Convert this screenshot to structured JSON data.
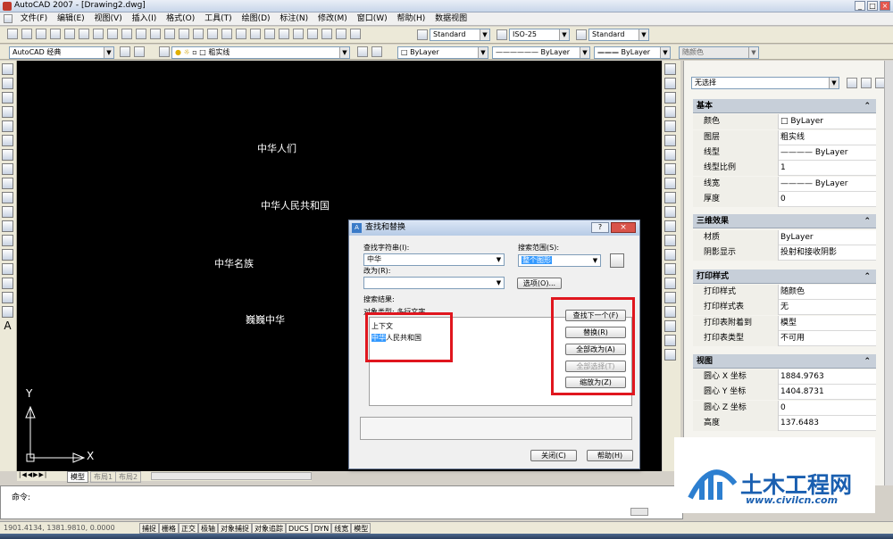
{
  "app": {
    "title": "AutoCAD 2007 - [Drawing2.dwg]"
  },
  "menu": [
    "文件(F)",
    "编辑(E)",
    "视图(V)",
    "插入(I)",
    "格式(O)",
    "工具(T)",
    "绘图(D)",
    "标注(N)",
    "修改(M)",
    "窗口(W)",
    "帮助(H)",
    "数据视图"
  ],
  "toolbar": {
    "text_style": "Standard",
    "dim_style": "ISO-25",
    "table_style": "Standard",
    "workspace": "AutoCAD 经典",
    "layer": "粗实线",
    "color": "ByLayer",
    "linetype": "ByLayer",
    "lineweight": "ByLayer",
    "plotstyle": "随颜色"
  },
  "canvas": {
    "texts": [
      "中华人们",
      "中华人民共和国",
      "中华名族",
      "巍巍中华"
    ],
    "ucs_y": "Y",
    "ucs_x": "X"
  },
  "layout_tabs": [
    "模型",
    "布局1",
    "布局2"
  ],
  "command": {
    "prompt": "命令:"
  },
  "status": {
    "coords": "1901.4134, 1381.9810, 0.0000",
    "toggles": [
      "捕捉",
      "栅格",
      "正交",
      "极轴",
      "对象捕捉",
      "对象追踪",
      "DUCS",
      "DYN",
      "线宽",
      "模型"
    ]
  },
  "properties": {
    "selection": "无选择",
    "sections": [
      {
        "title": "基本",
        "rows": [
          [
            "颜色",
            "□ ByLayer"
          ],
          [
            "图层",
            "粗实线"
          ],
          [
            "线型",
            "———— ByLayer"
          ],
          [
            "线型比例",
            "1"
          ],
          [
            "线宽",
            "———— ByLayer"
          ],
          [
            "厚度",
            "0"
          ]
        ]
      },
      {
        "title": "三维效果",
        "rows": [
          [
            "材质",
            "ByLayer"
          ],
          [
            "阴影显示",
            "投射和接收阴影"
          ]
        ]
      },
      {
        "title": "打印样式",
        "rows": [
          [
            "打印样式",
            "随颜色"
          ],
          [
            "打印样式表",
            "无"
          ],
          [
            "打印表附着到",
            "模型"
          ],
          [
            "打印表类型",
            "不可用"
          ]
        ]
      },
      {
        "title": "视图",
        "rows": [
          [
            "圆心 X 坐标",
            "1884.9763"
          ],
          [
            "圆心 Y 坐标",
            "1404.8731"
          ],
          [
            "圆心 Z 坐标",
            "0"
          ],
          [
            "高度",
            "137.6483"
          ]
        ]
      }
    ]
  },
  "dialog": {
    "title": "查找和替换",
    "find_label": "查找字符串(I):",
    "find_value": "中华",
    "replace_label": "改为(R):",
    "replace_value": "",
    "scope_label": "搜索范围(S):",
    "scope_value": "整个图形",
    "options_button": "选项(O)...",
    "results_label": "搜索结果:",
    "object_type": "对象类型: 多行文字",
    "context_label": "上下文",
    "context_highlight": "中华",
    "context_rest": "人民共和国",
    "find_next": "查找下一个(F)",
    "replace": "替换(R)",
    "replace_all": "全部改为(A)",
    "select_all": "全部选择(T)",
    "zoom_to": "缩放为(Z)",
    "close": "关闭(C)",
    "help": "帮助(H)"
  },
  "watermark": {
    "brand": "土木工程网",
    "url": "www.civilcn.com"
  },
  "colors": {
    "highlight_red": "#e0161e",
    "canvas_bg": "#000000",
    "selection_blue": "#3399ff"
  }
}
